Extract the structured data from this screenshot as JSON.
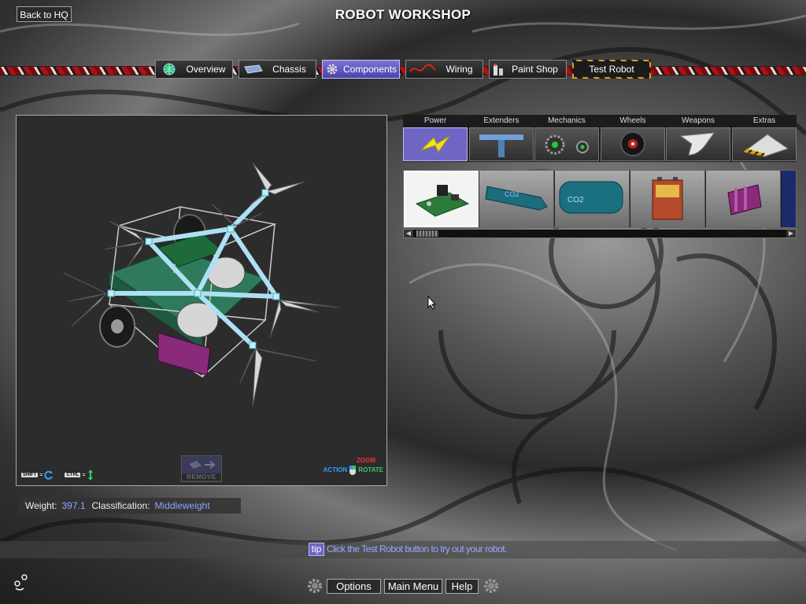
{
  "header": {
    "back_label": "Back to HQ",
    "title": "ROBOT WORKSHOP"
  },
  "tabs": [
    {
      "label": "Overview",
      "icon": "globe-icon",
      "active": false
    },
    {
      "label": "Chassis",
      "icon": "chassis-icon",
      "active": false
    },
    {
      "label": "Components",
      "icon": "gear-icon",
      "active": true
    },
    {
      "label": "Wiring",
      "icon": "wire-icon",
      "active": false
    },
    {
      "label": "Paint Shop",
      "icon": "paint-can-icon",
      "active": false
    },
    {
      "label": "Test Robot",
      "icon": "",
      "active": false
    }
  ],
  "viewport": {
    "remove_label": "REMOVE",
    "hints": {
      "shift": "SHIFT",
      "ctrl": "CTRL",
      "zoom": "ZOOM",
      "action": "ACTION",
      "rotate": "ROTATE"
    }
  },
  "categories": [
    {
      "label": "Power",
      "icon": "lightning-icon",
      "active": true
    },
    {
      "label": "Extenders",
      "icon": "extender-icon",
      "active": false
    },
    {
      "label": "Mechanics",
      "icon": "chain-icon",
      "active": false
    },
    {
      "label": "Wheels",
      "icon": "wheel-icon",
      "active": false
    },
    {
      "label": "Weapons",
      "icon": "blade-icon",
      "active": false
    },
    {
      "label": "Extras",
      "icon": "wedge-icon",
      "active": false
    }
  ],
  "parts": [
    {
      "name": "circuit-board",
      "selected": true
    },
    {
      "name": "co2-tank-small",
      "printed": "CO2",
      "selected": false
    },
    {
      "name": "co2-tank-large",
      "printed": "CO2",
      "selected": false
    },
    {
      "name": "battery-box",
      "selected": false
    },
    {
      "name": "battery-pack",
      "selected": false
    }
  ],
  "stats": {
    "weight_label": "Weight:",
    "weight_value": "397.1",
    "class_label": "Classification:",
    "class_value": "Middleweight"
  },
  "tip": {
    "tag": "tip",
    "text": "Click the Test Robot button to try out your robot."
  },
  "footer": {
    "options": "Options",
    "main_menu": "Main Menu",
    "help": "Help"
  },
  "colors": {
    "accent": "#6f66c4",
    "highlight": "#8fa4ff",
    "robot_frame": "#aee0f5",
    "robot_base": "#3c8a6a"
  }
}
